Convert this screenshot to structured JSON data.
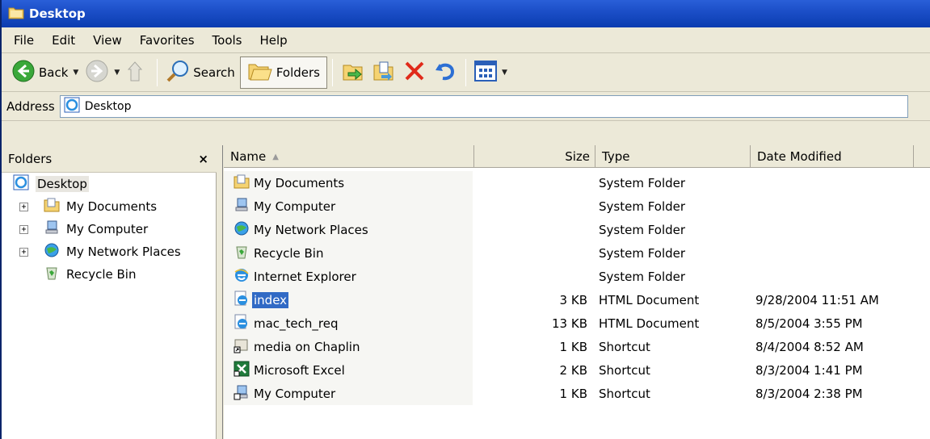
{
  "window": {
    "title": "Desktop"
  },
  "menu": [
    "File",
    "Edit",
    "View",
    "Favorites",
    "Tools",
    "Help"
  ],
  "toolbar": {
    "back_label": "Back",
    "search_label": "Search",
    "folders_label": "Folders"
  },
  "address": {
    "label": "Address",
    "value": "Desktop"
  },
  "folders_pane": {
    "title": "Folders",
    "close_glyph": "×",
    "root": "Desktop",
    "items": [
      {
        "label": "My Documents",
        "expander": "+"
      },
      {
        "label": "My Computer",
        "expander": "+"
      },
      {
        "label": "My Network Places",
        "expander": "+"
      },
      {
        "label": "Recycle Bin",
        "expander": ""
      }
    ]
  },
  "columns": {
    "name": "Name",
    "size": "Size",
    "type": "Type",
    "date": "Date Modified",
    "sort_glyph": "▲"
  },
  "files": [
    {
      "name": "My Documents",
      "size": "",
      "type": "System Folder",
      "date": "",
      "icon": "my-documents-icon"
    },
    {
      "name": "My Computer",
      "size": "",
      "type": "System Folder",
      "date": "",
      "icon": "my-computer-icon"
    },
    {
      "name": "My Network Places",
      "size": "",
      "type": "System Folder",
      "date": "",
      "icon": "network-places-icon"
    },
    {
      "name": "Recycle Bin",
      "size": "",
      "type": "System Folder",
      "date": "",
      "icon": "recycle-bin-icon"
    },
    {
      "name": "Internet Explorer",
      "size": "",
      "type": "System Folder",
      "date": "",
      "icon": "internet-explorer-icon"
    },
    {
      "name": "index",
      "size": "3 KB",
      "type": "HTML Document",
      "date": "9/28/2004 11:51 AM",
      "icon": "html-document-icon",
      "selected": true
    },
    {
      "name": "mac_tech_req",
      "size": "13 KB",
      "type": "HTML Document",
      "date": "8/5/2004 3:55 PM",
      "icon": "html-document-icon"
    },
    {
      "name": "media on Chaplin",
      "size": "1 KB",
      "type": "Shortcut",
      "date": "8/4/2004 8:52 AM",
      "icon": "shortcut-icon"
    },
    {
      "name": "Microsoft Excel",
      "size": "2 KB",
      "type": "Shortcut",
      "date": "8/3/2004 1:41 PM",
      "icon": "excel-icon"
    },
    {
      "name": "My Computer",
      "size": "1 KB",
      "type": "Shortcut",
      "date": "8/3/2004 2:38 PM",
      "icon": "computer-shortcut-icon"
    }
  ],
  "colors": {
    "title_bar": "#0a3cb0",
    "selection": "#316ac5",
    "chrome": "#ece9d8"
  }
}
